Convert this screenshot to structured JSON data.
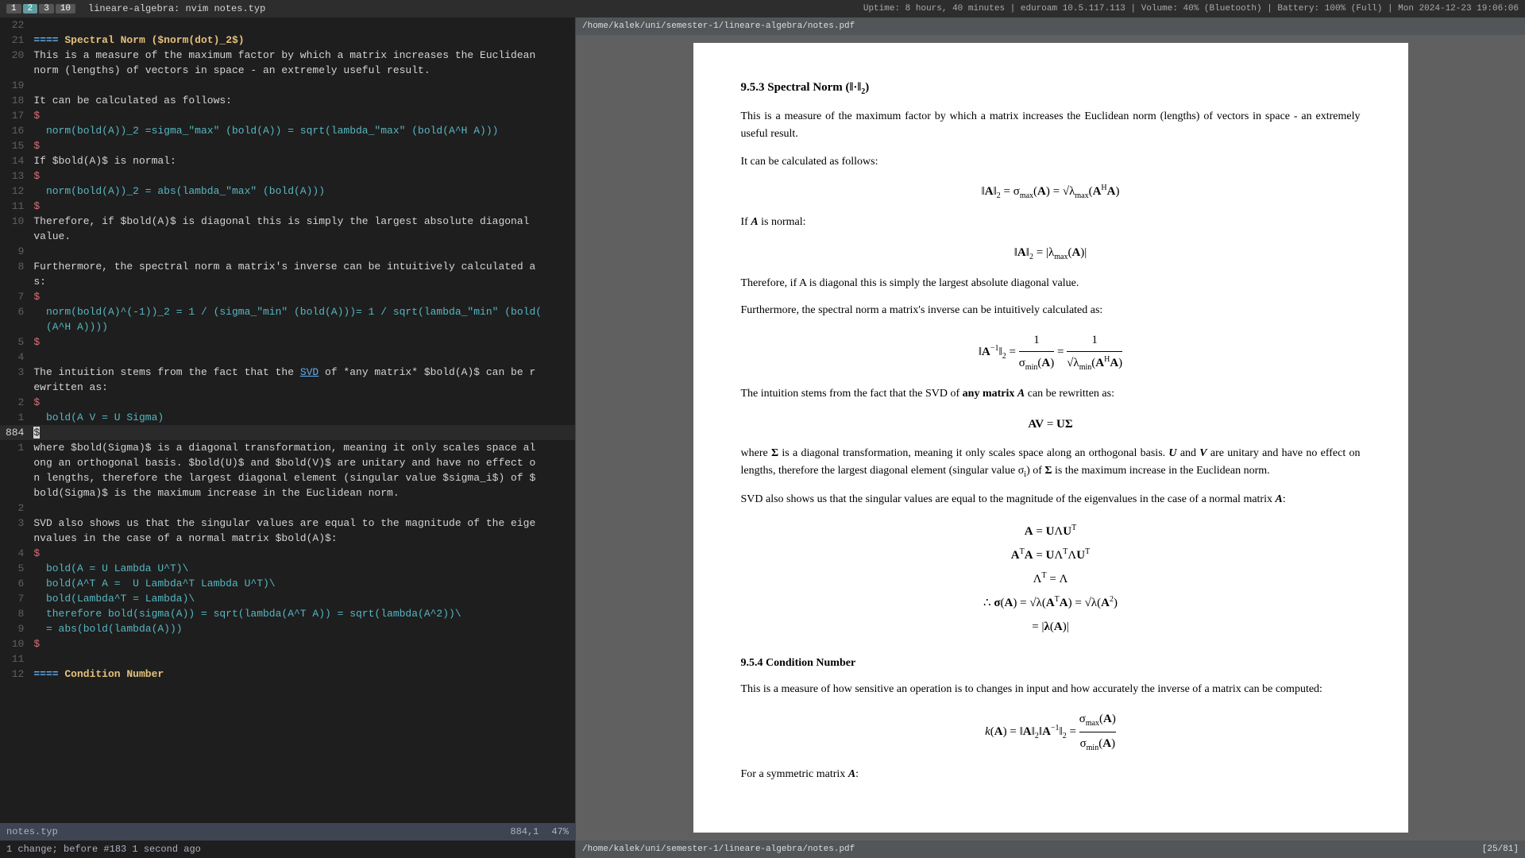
{
  "topbar": {
    "tabs": [
      "1",
      "2",
      "3",
      "10"
    ],
    "active_tab": "2",
    "title": "lineare-algebra:  nvim notes.typ",
    "system_info": "Uptime: 8 hours, 40 minutes  |  eduroam 10.5.117.113  |  Volume: 40% (Bluetooth)  |  Battery: 100% (Full)  |  Mon 2024-12-23 19:06:06"
  },
  "editor": {
    "filename": "notes.typ",
    "mode": "",
    "cursor_pos": "884,1",
    "scroll_pct": "47%",
    "change_msg": "1 change; before #183  1 second ago",
    "lines": [
      {
        "num": "22",
        "content": ""
      },
      {
        "num": "21",
        "content": "==== Spectral Norm ($norm(dot)_2$)",
        "type": "heading"
      },
      {
        "num": "20",
        "content": "This is a measure of the maximum factor by which a matrix increases the Euclidean",
        "type": "text"
      },
      {
        "num": "",
        "content": "norm (lengths) of vectors in space - an extremely useful result.",
        "type": "text"
      },
      {
        "num": "19",
        "content": ""
      },
      {
        "num": "18",
        "content": "It can be calculated as follows:",
        "type": "text"
      },
      {
        "num": "17",
        "content": "$",
        "type": "math"
      },
      {
        "num": "16",
        "content": "  norm(bold(A))_2 =sigma_\"max\" (bold(A)) = sqrt(lambda_\"max\" (bold(A^H A)))",
        "type": "math"
      },
      {
        "num": "15",
        "content": "$",
        "type": "math"
      },
      {
        "num": "14",
        "content": "If $bold(A)$ is normal:",
        "type": "text"
      },
      {
        "num": "13",
        "content": "$",
        "type": "math"
      },
      {
        "num": "12",
        "content": "  norm(bold(A))_2 = abs(lambda_\"max\" (bold(A)))",
        "type": "math"
      },
      {
        "num": "11",
        "content": "$",
        "type": "math"
      },
      {
        "num": "10",
        "content": "Therefore, if $bold(A)$ is diagonal this is simply the largest absolute diagonal",
        "type": "text"
      },
      {
        "num": "",
        "content": "value.",
        "type": "text"
      },
      {
        "num": "9",
        "content": ""
      },
      {
        "num": "8",
        "content": "Furthermore, the spectral norm a matrix's inverse can be intuitively calculated a",
        "type": "text"
      },
      {
        "num": "",
        "content": "s:",
        "type": "text"
      },
      {
        "num": "7",
        "content": "$",
        "type": "math"
      },
      {
        "num": "6",
        "content": "  norm(bold(A)^(-1))_2 = 1 / (sigma_\"min\" (bold(A)))= 1 / sqrt(lambda_\"min\" (bold(",
        "type": "math"
      },
      {
        "num": "",
        "content": "  (A^H A))))",
        "type": "math"
      },
      {
        "num": "5",
        "content": "$",
        "type": "math"
      },
      {
        "num": "4",
        "content": ""
      },
      {
        "num": "3",
        "content": "The intuition stems from the fact that the SVD of *any matrix* $bold(A)$ can be r",
        "type": "text"
      },
      {
        "num": "",
        "content": "ewritten as:",
        "type": "text"
      },
      {
        "num": "2",
        "content": "$",
        "type": "math"
      },
      {
        "num": "1",
        "content": "  bold(A V = U Sigma)",
        "type": "math"
      },
      {
        "num": "884",
        "content": "$",
        "type": "current",
        "cursor": true
      },
      {
        "num": "1",
        "content": "where $bold(Sigma)$ is a diagonal transformation, meaning it only scales space al",
        "type": "text"
      },
      {
        "num": "",
        "content": "ong an orthogonal basis. $bold(U)$ and $bold(V)$ are unitary and have no effect o",
        "type": "text"
      },
      {
        "num": "",
        "content": "n lengths, therefore the largest diagonal element (singular value $sigma_i$) of $",
        "type": "text"
      },
      {
        "num": "",
        "content": "bold(Sigma)$ is the maximum increase in the Euclidean norm.",
        "type": "text"
      },
      {
        "num": "2",
        "content": ""
      },
      {
        "num": "3",
        "content": "SVD also shows us that the singular values are equal to the magnitude of the eige",
        "type": "text"
      },
      {
        "num": "",
        "content": "nvalues in the case of a normal matrix $bold(A)$:",
        "type": "text"
      },
      {
        "num": "4",
        "content": "$",
        "type": "math"
      },
      {
        "num": "5",
        "content": "  bold(A = U Lambda U^T)\\",
        "type": "math"
      },
      {
        "num": "6",
        "content": "  bold(A^T A =  U Lambda^T Lambda U^T)\\",
        "type": "math"
      },
      {
        "num": "7",
        "content": "  bold(Lambda^T = Lambda)\\",
        "type": "math"
      },
      {
        "num": "8",
        "content": "  therefore bold(sigma(A)) = sqrt(lambda(A^T A)) = sqrt(lambda(A^2))\\",
        "type": "math"
      },
      {
        "num": "9",
        "content": "  = abs(bold(lambda(A)))",
        "type": "math"
      },
      {
        "num": "10",
        "content": "$",
        "type": "math"
      },
      {
        "num": "11",
        "content": ""
      },
      {
        "num": "12",
        "content": "==== Condition Number",
        "type": "heading"
      }
    ]
  },
  "pdf": {
    "path": "/home/kalek/uni/semester-1/lineare-algebra/notes.pdf",
    "page_info": "[25/81]",
    "bottom_path": "/home/kalek/uni/semester-1/lineare-algebra/notes.pdf",
    "sections": {
      "spectral_norm": {
        "title": "9.5.3 Spectral Norm (‖·‖₂)",
        "intro": "This is a measure of the maximum factor by which a matrix increases the Euclidean norm (lengths) of vectors in space - an extremely useful result.",
        "calc_intro": "It can be calculated as follows:",
        "normal_condition": "If A is normal:",
        "diagonal_note": "Therefore, if A is diagonal this is simply the largest absolute diagonal value.",
        "inverse_intro": "Furthermore, the spectral norm a matrix's inverse can be intuitively calculated as:",
        "intuition": "The intuition stems from the fact that the SVD of any matrix A can be rewritten as:",
        "svd_explanation": "where Σ is a diagonal transformation, meaning it only scales space along an orthogonal basis. U and V are unitary and have no effect on lengths, therefore the largest diagonal element (singular value σᵢ) of Σ is the maximum increase in the Euclidean norm.",
        "svd_note": "SVD also shows us that the singular values are equal to the magnitude of the eigenvalues in the case of a normal matrix A:"
      },
      "condition_number": {
        "title": "9.5.4 Condition Number",
        "intro": "This is a measure of how sensitive an operation is to changes in input and how accurately the inverse of a matrix can be computed:"
      }
    }
  }
}
